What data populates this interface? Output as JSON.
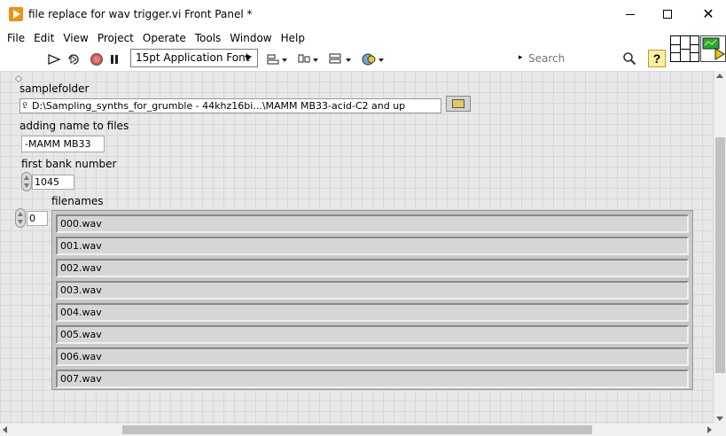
{
  "window": {
    "title": "file replace for wav trigger.vi Front Panel *"
  },
  "menu": [
    "File",
    "Edit",
    "View",
    "Project",
    "Operate",
    "Tools",
    "Window",
    "Help"
  ],
  "toolbar": {
    "font": "15pt Application Font",
    "search_placeholder": "Search",
    "help_label": "?"
  },
  "panel": {
    "samplefolder_label": "samplefolder",
    "samplefolder_value": "D:\\Sampling_synths_for_grumble - 44khz16bi...\\MAMM MB33-acid-C2 and up",
    "adding_name_label": "adding name to files",
    "adding_name_value": "-MAMM MB33",
    "first_bank_label": "first bank number",
    "first_bank_value": "1045",
    "filenames_label": "filenames",
    "array_index": "0",
    "filenames": [
      "000.wav",
      "001.wav",
      "002.wav",
      "003.wav",
      "004.wav",
      "005.wav",
      "006.wav",
      "007.wav"
    ]
  }
}
